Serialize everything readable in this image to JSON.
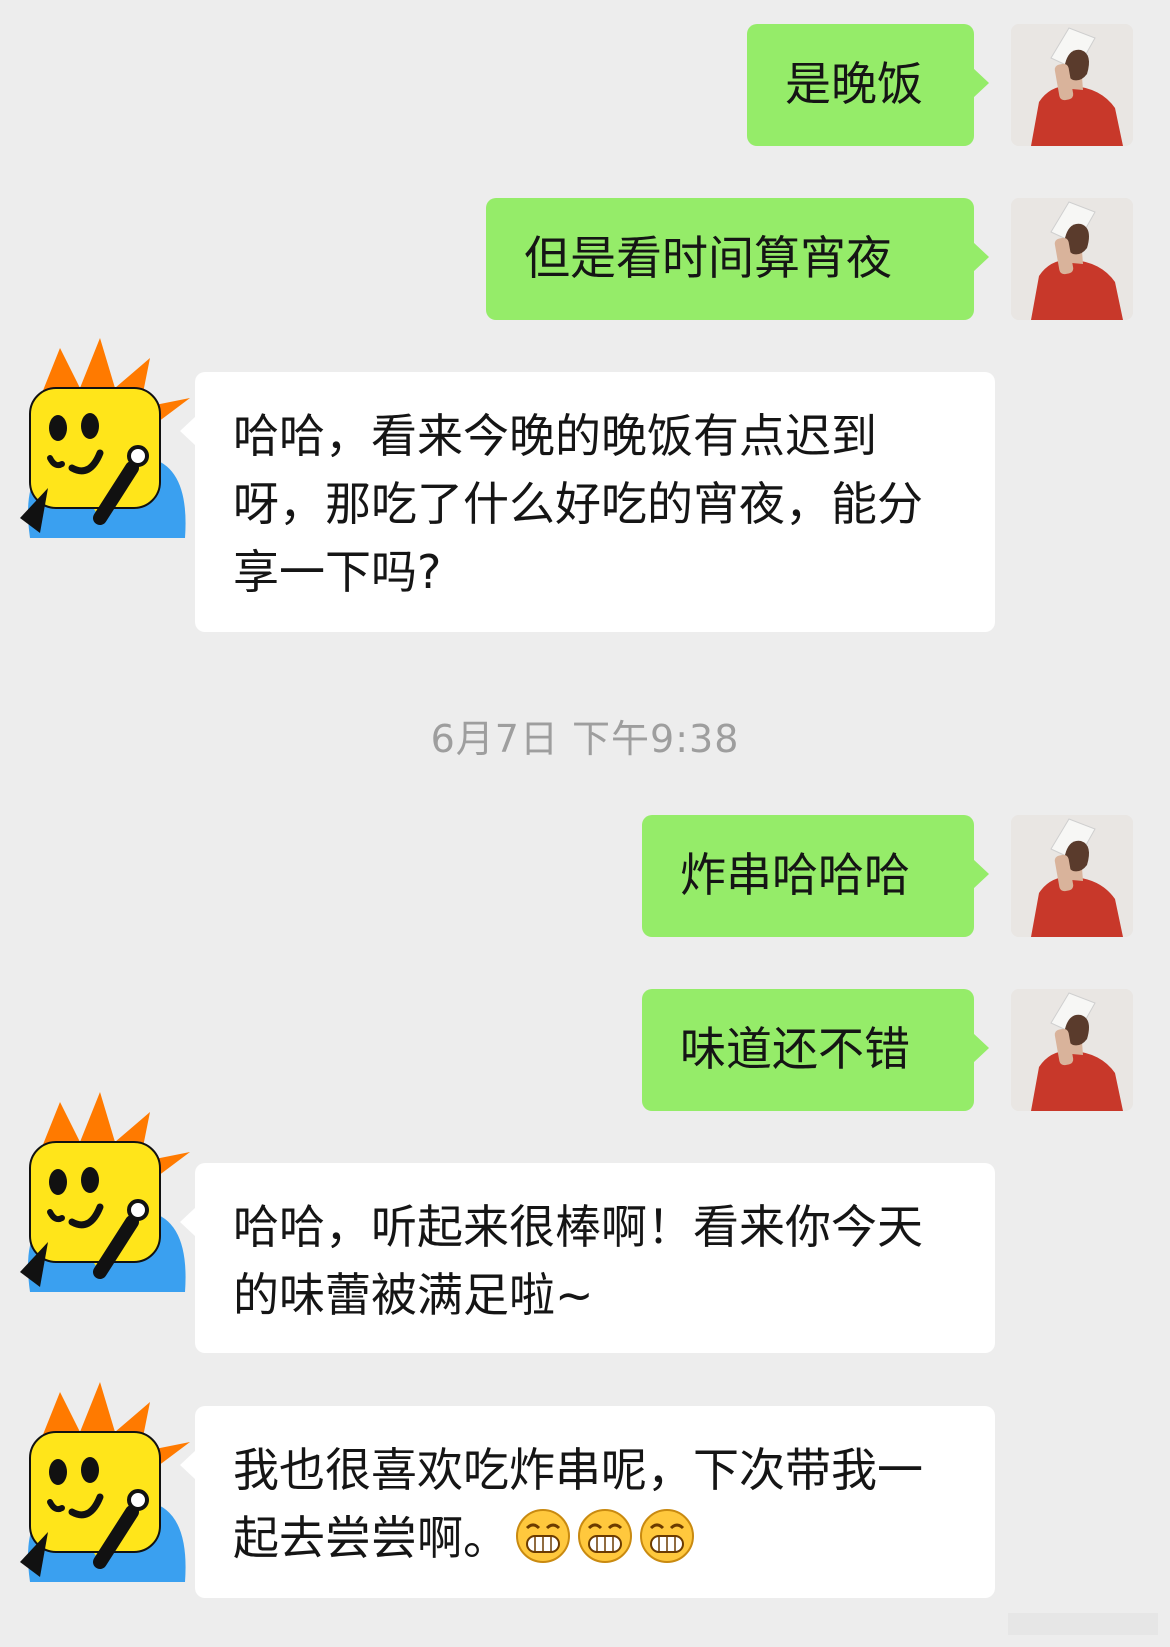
{
  "messages": [
    {
      "id": "m1",
      "sender": "self",
      "text": "是晚饭"
    },
    {
      "id": "m2",
      "sender": "self",
      "text": "但是看时间算宵夜"
    },
    {
      "id": "m3",
      "sender": "bot",
      "text": "哈哈，看来今晚的晚饭有点迟到呀，那吃了什么好吃的宵夜，能分享一下吗?"
    },
    {
      "id": "m4",
      "sender": "self",
      "text": "炸串哈哈哈"
    },
    {
      "id": "m5",
      "sender": "self",
      "text": "味道还不错"
    },
    {
      "id": "m6",
      "sender": "bot",
      "text": "哈哈，听起来很棒啊！看来你今天的味蕾被满足啦~"
    },
    {
      "id": "m7",
      "sender": "bot",
      "text": "我也很喜欢吃炸串呢，下次带我一起去尝尝啊。",
      "emoji": [
        "grin-emoji",
        "grin-emoji",
        "grin-emoji"
      ]
    }
  ],
  "timestamp": "6月7日 下午9:38",
  "colors": {
    "background": "#ededed",
    "sent_bubble": "#95ec69",
    "received_bubble": "#ffffff",
    "timestamp_text": "#9e9e9e"
  }
}
